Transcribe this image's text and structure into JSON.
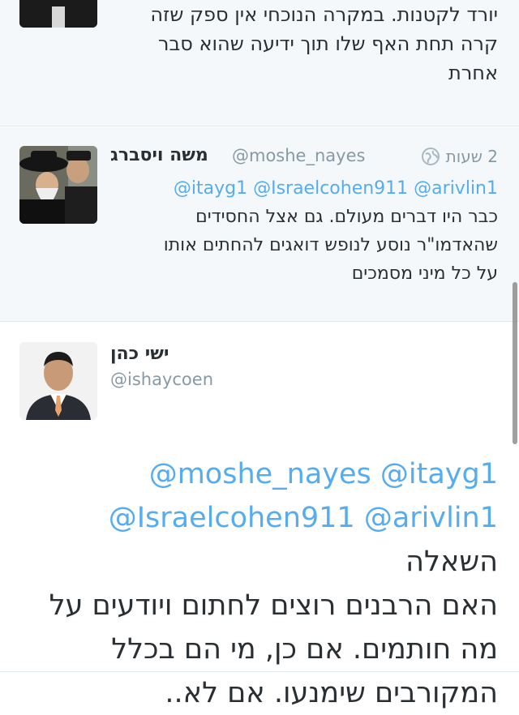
{
  "tweets": {
    "top": {
      "text_lines": [
        "יורד לקטנות. במקרה הנוכחי אין ספק שזה",
        "קרה תחת האף שלו תוך ידיעה שהוא סבר",
        "אחרת"
      ]
    },
    "middle": {
      "name": "משה ויסברג",
      "handle": "@moshe_nayes",
      "time": "2 שעות",
      "mentions": "@itayg1 @Israelcohen911 @arivlin1",
      "text_lines": [
        "כבר היו דברים מעולם. גם אצל החסידים",
        "שהאדמו\"ר נוסע לנופש דואגים להחתים אותו",
        "על כל מיני מסמכים"
      ]
    },
    "main": {
      "name": "ישי כהן",
      "handle": "@ishaycoen",
      "line1": "@moshe_nayes @itayg1",
      "line2_mentions": "@Israelcohen911 @arivlin1",
      "line2_word": "השאלה",
      "text_lines": [
        "האם הרבנים רוצים לחתום ויודעים על",
        "מה חותמים. אם כן, מי הם בכלל",
        "המקורבים שימנעו. אם לא.."
      ]
    }
  },
  "colors": {
    "link": "#55acee",
    "text": "#292f33",
    "muted": "#8899a6",
    "background_alt": "#f5f8fa"
  },
  "icons": {
    "time_icon": "globe-icon"
  }
}
